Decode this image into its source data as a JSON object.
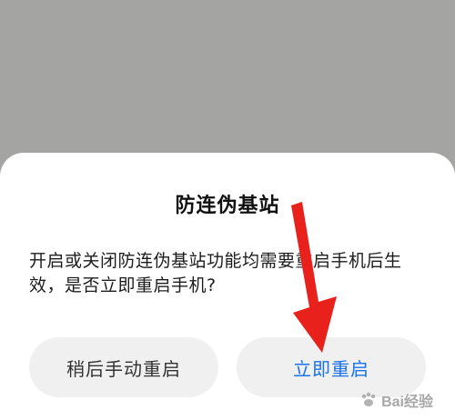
{
  "dialog": {
    "title": "防连伪基站",
    "message": "开启或关闭防连伪基站功能均需要重启手机后生效，是否立即重启手机?",
    "buttons": {
      "later_label": "稍后手动重启",
      "now_label": "立即重启"
    }
  },
  "overlay": {
    "arrow_icon": "red-arrow-pointer",
    "watermark_text": "Bai经验"
  },
  "colors": {
    "backdrop": "#a4a4a3",
    "dialog_bg": "#ffffff",
    "button_bg": "#f0f0f0",
    "primary_text": "#1a73e8",
    "annotation_red": "#e8211c"
  }
}
